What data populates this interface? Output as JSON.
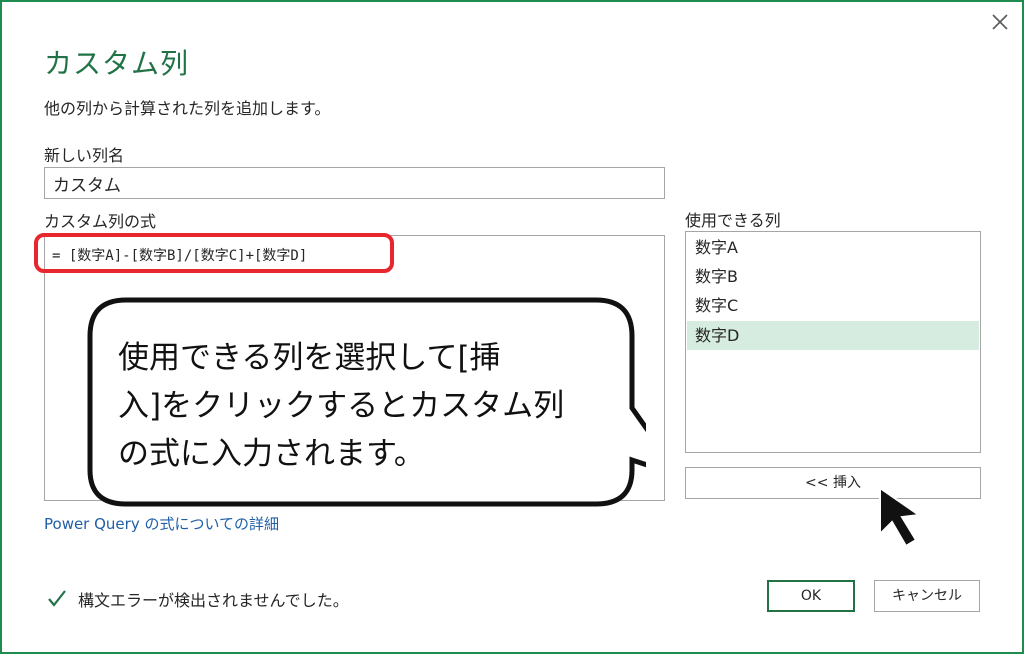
{
  "dialog": {
    "title": "カスタム列",
    "subtitle": "他の列から計算された列を追加します。",
    "close_icon": "close-icon"
  },
  "new_column": {
    "label": "新しい列名",
    "value": "カスタム"
  },
  "formula": {
    "label": "カスタム列の式",
    "value": "= [数字A]-[数字B]/[数字C]+[数字D]"
  },
  "available_columns": {
    "label": "使用できる列",
    "items": [
      {
        "label": "数字A",
        "selected": false
      },
      {
        "label": "数字B",
        "selected": false
      },
      {
        "label": "数字C",
        "selected": false
      },
      {
        "label": "数字D",
        "selected": true
      }
    ],
    "insert_label": "<< 挿入"
  },
  "help_link": "Power Query の式についての詳細",
  "status": {
    "text": "構文エラーが検出されませんでした。",
    "icon": "checkmark-icon"
  },
  "buttons": {
    "ok": "OK",
    "cancel": "キャンセル"
  },
  "callout": {
    "line1": "使用できる列を選択して[挿",
    "line2": "入]をクリックするとカスタム列",
    "line3": "の式に入力されます。"
  },
  "colors": {
    "accent": "#217346",
    "border": "#1e8c4e",
    "highlight": "#e8262d",
    "selected_bg": "#d6ece0",
    "link": "#1f5fa8"
  }
}
